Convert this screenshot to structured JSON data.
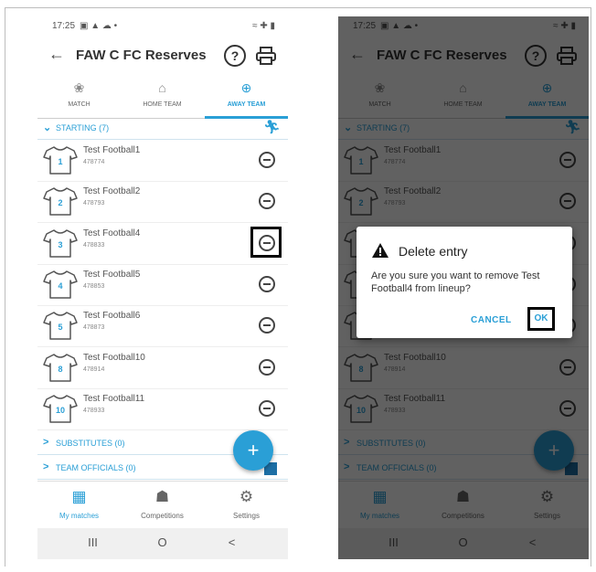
{
  "status_bar": {
    "time": "17:25",
    "left_icons": "▣ ▲ ☁ •",
    "right_icons": "≈ ✚ ▮"
  },
  "app_bar": {
    "title": "FAW C FC Reserves",
    "back_icon": "←",
    "help_icon": "?"
  },
  "tabs": [
    {
      "label": "MATCH",
      "icon": "❀",
      "active": false
    },
    {
      "label": "HOME TEAM",
      "icon": "⌂",
      "active": false
    },
    {
      "label": "AWAY TEAM",
      "icon": "⊕",
      "active": true
    }
  ],
  "starting": {
    "label": "STARTING (7)",
    "chevron": "⌄",
    "runner_icon": "⚒"
  },
  "players": [
    {
      "shirt": "1",
      "name": "Test Football1",
      "id": "478774"
    },
    {
      "shirt": "2",
      "name": "Test Football2",
      "id": "478793"
    },
    {
      "shirt": "3",
      "name": "Test Football4",
      "id": "478833"
    },
    {
      "shirt": "4",
      "name": "Test Football5",
      "id": "478853"
    },
    {
      "shirt": "5",
      "name": "Test Football6",
      "id": "478873"
    },
    {
      "shirt": "8",
      "name": "Test Football10",
      "id": "478914"
    },
    {
      "shirt": "10",
      "name": "Test Football11",
      "id": "478933"
    }
  ],
  "substitutes": {
    "label": "SUBSTITUTES (0)",
    "chevron": ">"
  },
  "officials": {
    "label": "TEAM OFFICIALS (0)",
    "chevron": ">"
  },
  "fab": {
    "label": "+"
  },
  "bottom_nav": [
    {
      "label": "My matches",
      "icon": "▦",
      "active": true
    },
    {
      "label": "Competitions",
      "icon": "☗",
      "active": false
    },
    {
      "label": "Settings",
      "icon": "⚙",
      "active": false
    }
  ],
  "system_nav": {
    "recents": "III",
    "home": "O",
    "back": "<"
  },
  "dialog": {
    "title": "Delete entry",
    "message": "Are you sure you want to remove Test Football4 from lineup?",
    "cancel": "CANCEL",
    "ok": "OK"
  },
  "colors": {
    "accent": "#2a9fd6",
    "overlay": "#555555",
    "highlight_box": "#000000"
  }
}
